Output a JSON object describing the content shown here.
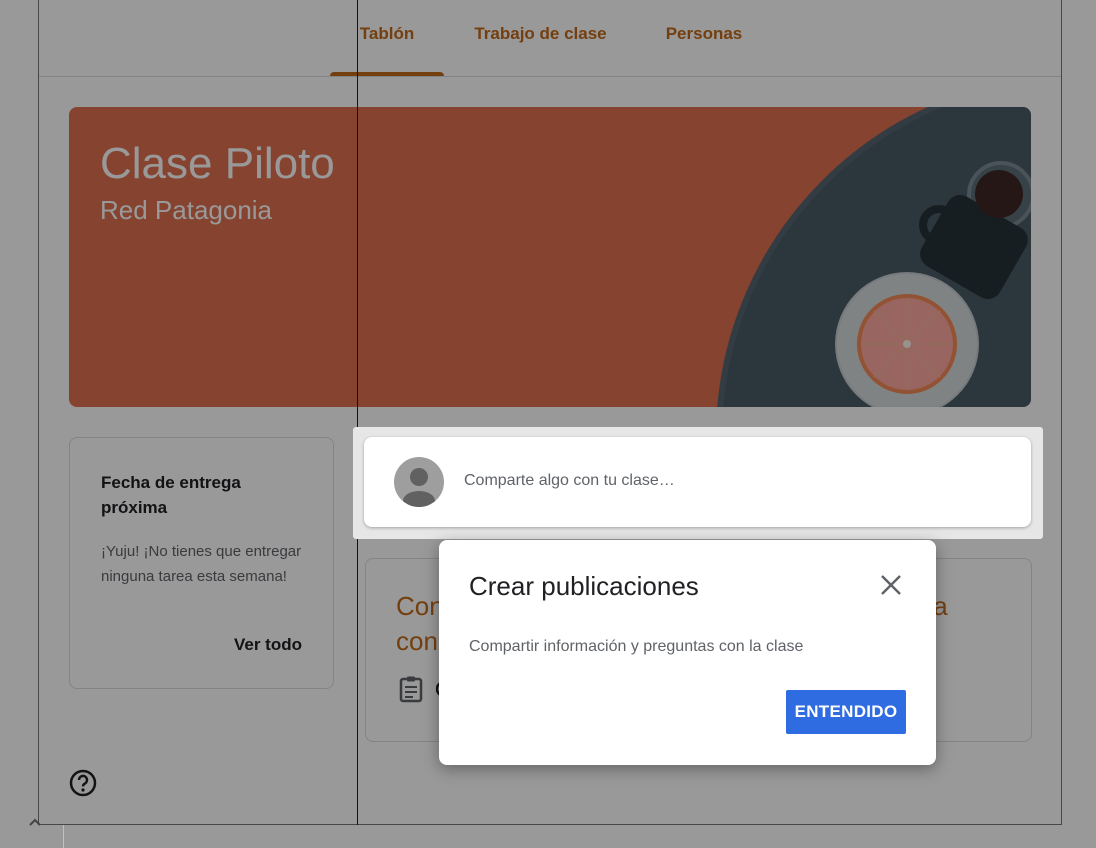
{
  "tabs": [
    {
      "label": "Tablón",
      "active": true
    },
    {
      "label": "Trabajo de clase",
      "active": false
    },
    {
      "label": "Personas",
      "active": false
    }
  ],
  "banner": {
    "title": "Clase Piloto",
    "subtitle": "Red Patagonia",
    "color": "#e0704f"
  },
  "due": {
    "title": "Fecha de entrega próxima",
    "text": "¡Yuju! ¡No tienes que entregar ninguna tarea esta semana!",
    "link": "Ver todo"
  },
  "composer": {
    "placeholder": "Comparte algo con tu clase…"
  },
  "post": {
    "title_visible_start": "Con",
    "title_visible_line2": "con",
    "title_visible_end": "ta",
    "icon": "assignment-icon"
  },
  "dialog": {
    "title": "Crear publicaciones",
    "body": "Compartir información y preguntas con la clase",
    "button": "ENTENDIDO"
  },
  "colors": {
    "accent": "#c26a1a",
    "primary_button": "#2f6ce1"
  }
}
